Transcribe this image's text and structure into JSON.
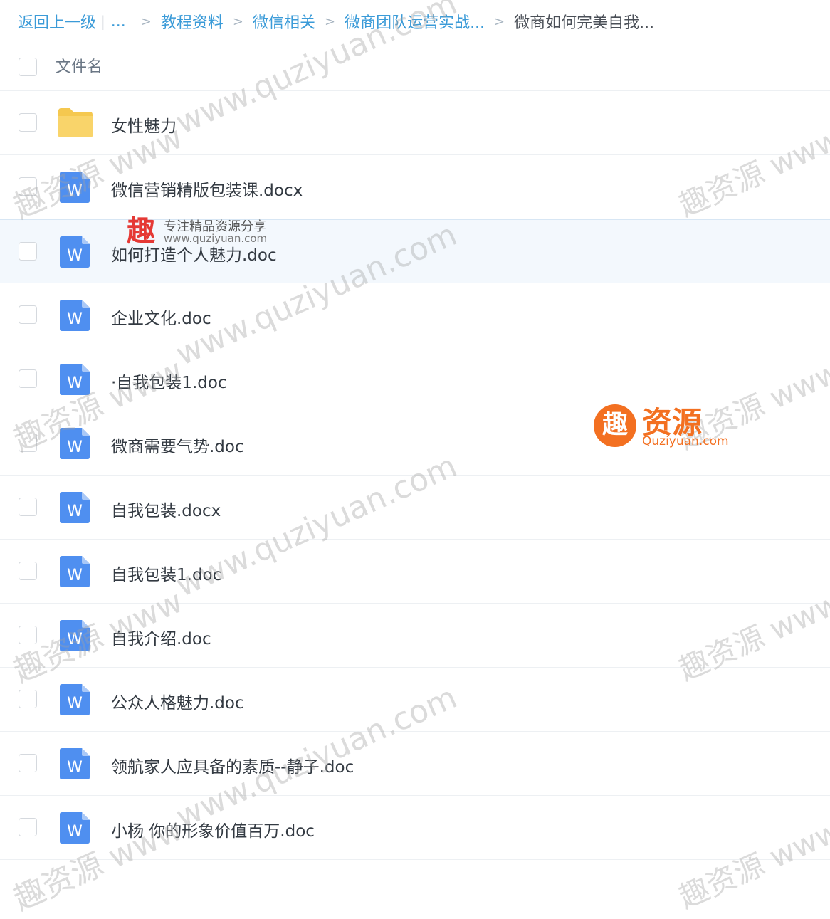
{
  "breadcrumb": {
    "back": "返回上一级",
    "ellipsis": "...",
    "items": [
      "教程资料",
      "微信相关",
      "微商团队运营实战..."
    ],
    "current": "微商如何完美自我...",
    "separator": ">"
  },
  "header": {
    "column_name": "文件名"
  },
  "files": [
    {
      "name": "女性魅力",
      "type": "folder"
    },
    {
      "name": "微信营销精版包装课.docx",
      "type": "word"
    },
    {
      "name": "如何打造个人魅力.doc",
      "type": "word"
    },
    {
      "name": "企业文化.doc",
      "type": "word"
    },
    {
      "name": "·自我包装1.doc",
      "type": "word"
    },
    {
      "name": "微商需要气势.doc",
      "type": "word"
    },
    {
      "name": "自我包装.docx",
      "type": "word"
    },
    {
      "name": "自我包装1.doc",
      "type": "word"
    },
    {
      "name": "自我介绍.doc",
      "type": "word"
    },
    {
      "name": "公众人格魅力.doc",
      "type": "word"
    },
    {
      "name": "领航家人应具备的素质--静子.doc",
      "type": "word"
    },
    {
      "name": "小杨 你的形象价值百万.doc",
      "type": "word"
    }
  ],
  "word_icon_letter": "W",
  "watermark": {
    "url_text": "www.quziyuan.com",
    "cn_text": "趣资源 www",
    "promo_char": "趣",
    "promo_tagline": "专注精品资源分享",
    "promo_url": "www.quziyuan.com",
    "brand_name": "资源",
    "brand_sub": "Quziyuan.com"
  },
  "colors": {
    "link": "#3b9bd8",
    "word_icon": "#4f8ff0",
    "folder": "#f9d46a",
    "promo_orange": "#f37021"
  }
}
